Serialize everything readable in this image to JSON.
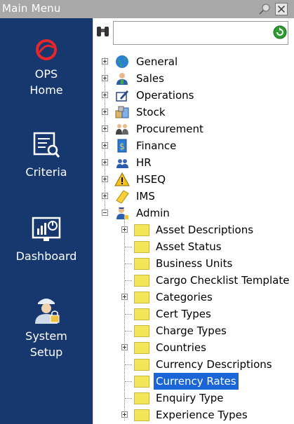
{
  "window": {
    "title": "Main Menu"
  },
  "sidebar": {
    "items": [
      {
        "label": "OPS\nHome",
        "line1": "OPS",
        "line2": "Home",
        "icon": "ops-logo-icon"
      },
      {
        "label": "Criteria",
        "icon": "criteria-search-icon"
      },
      {
        "label": "Dashboard",
        "icon": "dashboard-chart-icon"
      },
      {
        "label": "System Setup",
        "line1": "System",
        "line2": "Setup",
        "icon": "admin-user-lock-icon"
      }
    ]
  },
  "search": {
    "value": "",
    "placeholder": ""
  },
  "tree": {
    "top_items": [
      {
        "label": "General",
        "icon": "globe-icon"
      },
      {
        "label": "Sales",
        "icon": "sales-icon"
      },
      {
        "label": "Operations",
        "icon": "operations-icon"
      },
      {
        "label": "Stock",
        "icon": "stock-icon"
      },
      {
        "label": "Procurement",
        "icon": "procurement-icon"
      },
      {
        "label": "Finance",
        "icon": "finance-icon"
      },
      {
        "label": "HR",
        "icon": "hr-icon"
      },
      {
        "label": "HSEQ",
        "icon": "warning-icon"
      },
      {
        "label": "IMS",
        "icon": "ims-icon"
      },
      {
        "label": "Admin",
        "icon": "admin-icon"
      }
    ],
    "admin_children": [
      {
        "label": "Asset Descriptions",
        "expandable": true
      },
      {
        "label": "Asset Status",
        "expandable": false
      },
      {
        "label": "Business Units",
        "expandable": false
      },
      {
        "label": "Cargo Checklist Template",
        "expandable": false
      },
      {
        "label": "Categories",
        "expandable": true
      },
      {
        "label": "Cert Types",
        "expandable": false
      },
      {
        "label": "Charge Types",
        "expandable": false
      },
      {
        "label": "Countries",
        "expandable": true
      },
      {
        "label": "Currency Descriptions",
        "expandable": false
      },
      {
        "label": "Currency Rates",
        "expandable": false,
        "selected": true
      },
      {
        "label": "Enquiry Type",
        "expandable": false
      },
      {
        "label": "Experience Types",
        "expandable": true
      }
    ]
  },
  "colors": {
    "sidebar_bg": "#17386e",
    "selection": "#1a66d6",
    "titlebar": "#a8a8a8",
    "folder": "#f4e65a"
  }
}
